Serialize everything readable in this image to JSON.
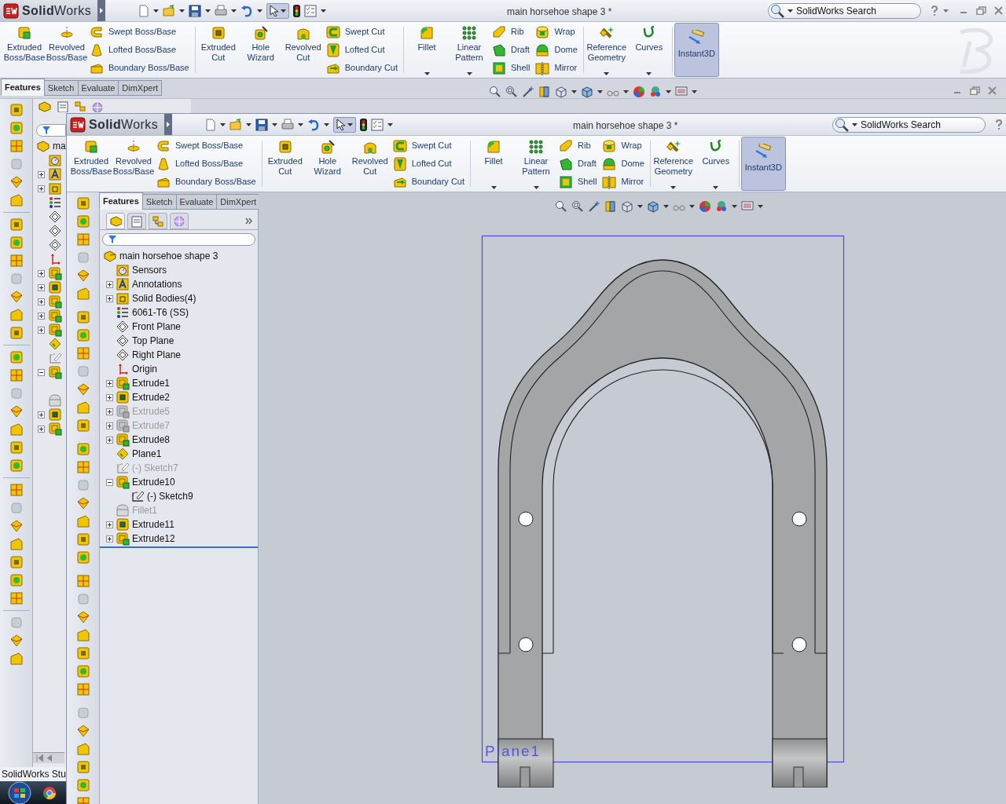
{
  "outer_window": {
    "app_name": "**Solid**Works",
    "title": "main horsehoe shape 3 *",
    "search": {
      "placeholder": "SolidWorks Search"
    },
    "ribbon": [
      {
        "items": [
          {
            "kind": "large",
            "label": "Extruded Boss/Base",
            "has_menu": false
          },
          {
            "kind": "large",
            "label": "Revolved Boss/Base",
            "has_menu": false
          },
          {
            "kind": "stack",
            "labels": [
              "Swept Boss/Base",
              "Lofted Boss/Base",
              "Boundary Boss/Base"
            ]
          }
        ]
      },
      {
        "items": [
          {
            "kind": "large",
            "label": "Extruded Cut",
            "has_menu": false
          },
          {
            "kind": "large",
            "label": "Hole Wizard",
            "has_menu": false
          },
          {
            "kind": "large",
            "label": "Revolved Cut",
            "has_menu": false
          },
          {
            "kind": "stack",
            "labels": [
              "Swept Cut",
              "Lofted Cut",
              "Boundary Cut"
            ]
          }
        ]
      },
      {
        "items": [
          {
            "kind": "large",
            "label": "Fillet",
            "has_menu": true
          },
          {
            "kind": "large",
            "label": "Linear Pattern",
            "has_menu": true
          },
          {
            "kind": "stack",
            "labels": [
              "Rib",
              "Draft",
              "Shell"
            ]
          },
          {
            "kind": "stack",
            "labels": [
              "Wrap",
              "Dome",
              "Mirror"
            ]
          }
        ]
      },
      {
        "items": [
          {
            "kind": "large",
            "label": "Reference Geometry",
            "has_menu": true
          },
          {
            "kind": "large",
            "label": "Curves",
            "has_menu": true
          }
        ]
      }
    ],
    "instant3d": {
      "label": "Instant3D",
      "on": true
    },
    "tabs": [
      {
        "label": "Features",
        "selected": true
      },
      {
        "label": "Sketch",
        "selected": false
      },
      {
        "label": "Evaluate",
        "selected": false
      },
      {
        "label": "DimXpert",
        "selected": false
      }
    ],
    "tree_fragment": "ma"
  },
  "inner_window": {
    "app_name": "**Solid**Works",
    "title": "main horsehoe shape 3 *",
    "search": {
      "placeholder": "SolidWorks Search"
    },
    "ribbon": [
      {
        "items": [
          {
            "kind": "large",
            "label": "Extruded Boss/Base",
            "has_menu": false
          },
          {
            "kind": "large",
            "label": "Revolved Boss/Base",
            "has_menu": false
          },
          {
            "kind": "stack",
            "labels": [
              "Swept Boss/Base",
              "Lofted Boss/Base",
              "Boundary Boss/Base"
            ]
          }
        ]
      },
      {
        "items": [
          {
            "kind": "large",
            "label": "Extruded Cut",
            "has_menu": false
          },
          {
            "kind": "large",
            "label": "Hole Wizard",
            "has_menu": false
          },
          {
            "kind": "large",
            "label": "Revolved Cut",
            "has_menu": false
          },
          {
            "kind": "stack",
            "labels": [
              "Swept Cut",
              "Lofted Cut",
              "Boundary Cut"
            ]
          }
        ]
      },
      {
        "items": [
          {
            "kind": "large",
            "label": "Fillet",
            "has_menu": true
          },
          {
            "kind": "large",
            "label": "Linear Pattern",
            "has_menu": true
          },
          {
            "kind": "stack",
            "labels": [
              "Rib",
              "Draft",
              "Shell"
            ]
          },
          {
            "kind": "stack",
            "labels": [
              "Wrap",
              "Dome",
              "Mirror"
            ]
          }
        ]
      },
      {
        "items": [
          {
            "kind": "large",
            "label": "Reference Geometry",
            "has_menu": true
          },
          {
            "kind": "large",
            "label": "Curves",
            "has_menu": true
          }
        ]
      }
    ],
    "instant3d": {
      "label": "Instant3D",
      "on": true
    },
    "tabs": [
      {
        "label": "Features",
        "selected": true
      },
      {
        "label": "Sketch",
        "selected": false
      },
      {
        "label": "Evaluate",
        "selected": false
      },
      {
        "label": "DimXpert",
        "selected": false
      }
    ],
    "panel_tabs": [
      {
        "selected": true
      },
      {
        "selected": false
      },
      {
        "selected": false
      },
      {
        "selected": false
      }
    ],
    "feature_tree": {
      "label": "main horsehoe shape 3",
      "kind": "part",
      "children": [
        {
          "label": "Sensors",
          "kind": "sensor",
          "suppressed": false
        },
        {
          "label": "Annotations",
          "kind": "annotation",
          "expanded": false,
          "suppressed": false
        },
        {
          "label": "Solid Bodies(4)",
          "kind": "folder",
          "expanded": false,
          "suppressed": false
        },
        {
          "label": "6061-T6 (SS)",
          "kind": "material",
          "suppressed": false
        },
        {
          "label": "Front Plane",
          "kind": "plane",
          "suppressed": false
        },
        {
          "label": "Top Plane",
          "kind": "plane",
          "suppressed": false
        },
        {
          "label": "Right Plane",
          "kind": "plane",
          "suppressed": false
        },
        {
          "label": "Origin",
          "kind": "origin",
          "suppressed": false
        },
        {
          "label": "Extrude1",
          "kind": "extrude",
          "expanded": false,
          "suppressed": false
        },
        {
          "label": "Extrude2",
          "kind": "cut",
          "expanded": false,
          "suppressed": false
        },
        {
          "label": "Extrude5",
          "kind": "extrude",
          "expanded": false,
          "suppressed": true
        },
        {
          "label": "Extrude7",
          "kind": "extrude",
          "expanded": false,
          "suppressed": true
        },
        {
          "label": "Extrude8",
          "kind": "extrude",
          "expanded": false,
          "suppressed": false
        },
        {
          "label": "Plane1",
          "kind": "ref_plane",
          "suppressed": false
        },
        {
          "label": "(-) Sketch7",
          "kind": "sketch",
          "suppressed": true
        },
        {
          "label": "Extrude10",
          "kind": "extrude",
          "expanded": true,
          "suppressed": false,
          "children": [
            {
              "label": "(-) Sketch9",
              "kind": "sketch",
              "suppressed": false
            }
          ]
        },
        {
          "label": "Fillet1",
          "kind": "fillet",
          "suppressed": true
        },
        {
          "label": "Extrude11",
          "kind": "cut",
          "expanded": false,
          "suppressed": false
        },
        {
          "label": "Extrude12",
          "kind": "extrude",
          "expanded": false,
          "suppressed": false
        }
      ]
    },
    "graphics": {
      "plane_label": "Plane1"
    }
  },
  "taskbar": {
    "task_label": "SolidWorks Stu"
  }
}
